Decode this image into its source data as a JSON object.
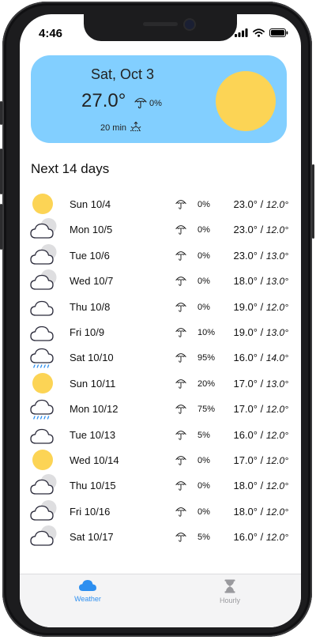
{
  "status_bar": {
    "time": "4:46"
  },
  "current": {
    "date": "Sat, Oct 3",
    "temperature": "27.0°",
    "precip_chance": "0%",
    "sunrise_countdown": "20 min",
    "condition_icon": "sun-icon",
    "sun_color": "#fcd455",
    "card_color": "#82cfff"
  },
  "section_title": "Next 14 days",
  "forecast": [
    {
      "day": "Sun 10/4",
      "icon": "sunny",
      "precip": "0%",
      "high": "23.0°",
      "low": "12.0°"
    },
    {
      "day": "Mon 10/5",
      "icon": "cloud-sun",
      "precip": "0%",
      "high": "23.0°",
      "low": "12.0°"
    },
    {
      "day": "Tue 10/6",
      "icon": "cloud-sun",
      "precip": "0%",
      "high": "23.0°",
      "low": "13.0°"
    },
    {
      "day": "Wed 10/7",
      "icon": "cloud-sun",
      "precip": "0%",
      "high": "18.0°",
      "low": "13.0°"
    },
    {
      "day": "Thu 10/8",
      "icon": "cloud",
      "precip": "0%",
      "high": "19.0°",
      "low": "12.0°"
    },
    {
      "day": "Fri 10/9",
      "icon": "cloud",
      "precip": "10%",
      "high": "19.0°",
      "low": "13.0°"
    },
    {
      "day": "Sat 10/10",
      "icon": "rain",
      "precip": "95%",
      "high": "16.0°",
      "low": "14.0°"
    },
    {
      "day": "Sun 10/11",
      "icon": "sunny",
      "precip": "20%",
      "high": "17.0°",
      "low": "13.0°"
    },
    {
      "day": "Mon 10/12",
      "icon": "rain",
      "precip": "75%",
      "high": "17.0°",
      "low": "12.0°"
    },
    {
      "day": "Tue 10/13",
      "icon": "cloud",
      "precip": "5%",
      "high": "16.0°",
      "low": "12.0°"
    },
    {
      "day": "Wed 10/14",
      "icon": "sunny",
      "precip": "0%",
      "high": "17.0°",
      "low": "12.0°"
    },
    {
      "day": "Thu 10/15",
      "icon": "cloud-sun",
      "precip": "0%",
      "high": "18.0°",
      "low": "12.0°"
    },
    {
      "day": "Fri 10/16",
      "icon": "cloud-sun",
      "precip": "0%",
      "high": "18.0°",
      "low": "12.0°"
    },
    {
      "day": "Sat 10/17",
      "icon": "cloud-sun",
      "precip": "5%",
      "high": "16.0°",
      "low": "12.0°"
    }
  ],
  "tabs": [
    {
      "label": "Weather",
      "icon": "cloud-icon",
      "active": true
    },
    {
      "label": "Hourly",
      "icon": "hourglass-icon",
      "active": false
    }
  ],
  "colors": {
    "accent": "#2d8ff0",
    "inactive": "#9a9a9e"
  }
}
